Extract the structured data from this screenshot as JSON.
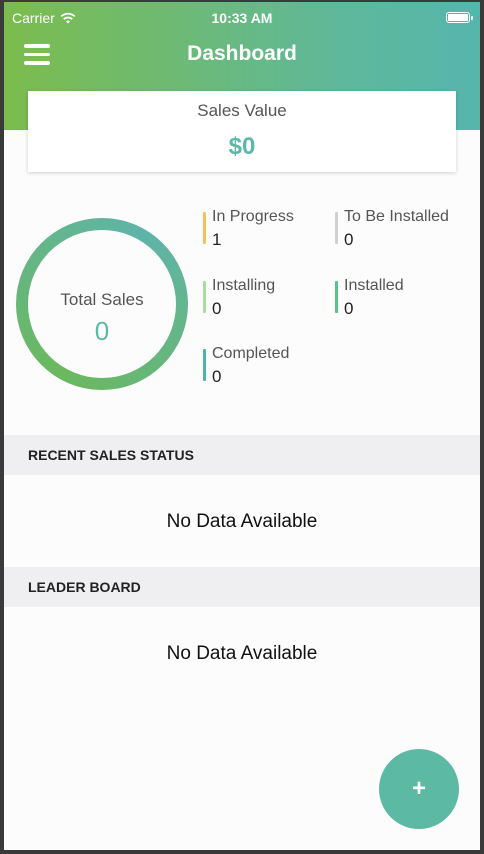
{
  "status_bar": {
    "carrier": "Carrier",
    "time": "10:33 AM"
  },
  "header": {
    "title": "Dashboard",
    "menu_icon": "hamburger-menu-icon"
  },
  "sales_value": {
    "label": "Sales Value",
    "amount": "$0"
  },
  "total_sales": {
    "label": "Total Sales",
    "value": "0"
  },
  "statuses": [
    {
      "label": "In Progress",
      "value": "1",
      "color": "#f0c35a"
    },
    {
      "label": "To Be Installed",
      "value": "0",
      "color": "#cfd0d3"
    },
    {
      "label": "Installing",
      "value": "0",
      "color": "#a9dda0"
    },
    {
      "label": "Installed",
      "value": "0",
      "color": "#5cc08a"
    },
    {
      "label": "Completed",
      "value": "0",
      "color": "#4fb3ad"
    }
  ],
  "sections": {
    "recent_sales": {
      "title": "RECENT SALES STATUS",
      "empty_text": "No Data Available"
    },
    "leader_board": {
      "title": "LEADER BOARD",
      "empty_text": "No Data Available"
    }
  },
  "fab": {
    "label": "+"
  },
  "colors": {
    "accent": "#5cb9a8",
    "header_start": "#7cbc4d",
    "header_end": "#55b6ad"
  }
}
